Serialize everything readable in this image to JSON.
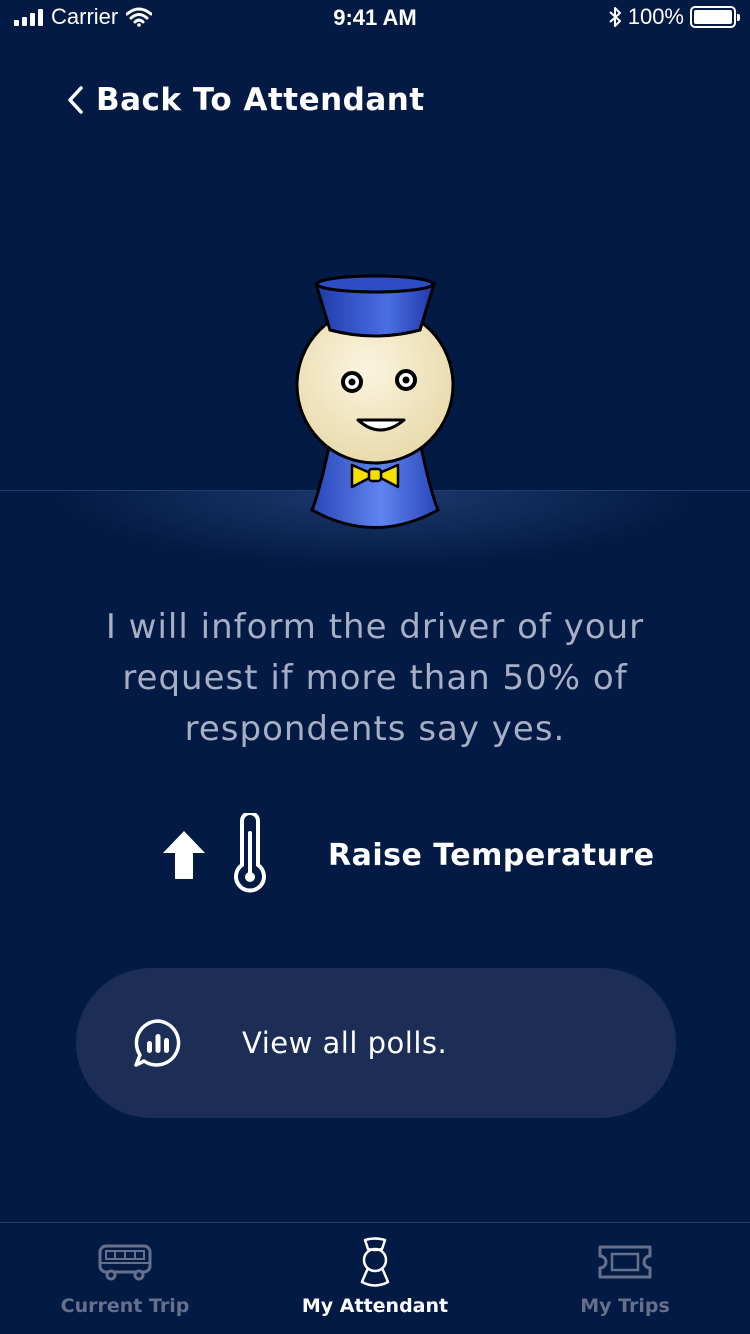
{
  "status_bar": {
    "carrier": "Carrier",
    "time": "9:41 AM",
    "battery": "100%"
  },
  "nav": {
    "back_label": "Back To Attendant"
  },
  "message": "I will inform the driver of your request if more than 50% of respondents say yes.",
  "request": {
    "label": "Raise Temperature",
    "direction_icon": "arrow-up-icon",
    "type_icon": "thermometer-icon"
  },
  "polls_button": {
    "label": "View all polls.",
    "icon": "poll-chat-icon"
  },
  "tabs": [
    {
      "label": "Current Trip",
      "icon": "bus-icon",
      "active": false
    },
    {
      "label": "My Attendant",
      "icon": "attendant-icon",
      "active": true
    },
    {
      "label": "My Trips",
      "icon": "ticket-icon",
      "active": false
    }
  ],
  "colors": {
    "background": "#031a44",
    "button_bg": "#1c2e56",
    "message_text": "#a6afc4",
    "inactive_tab": "#66708a",
    "mascot_blue": "#3a5cd6",
    "bowtie": "#f5e000"
  }
}
